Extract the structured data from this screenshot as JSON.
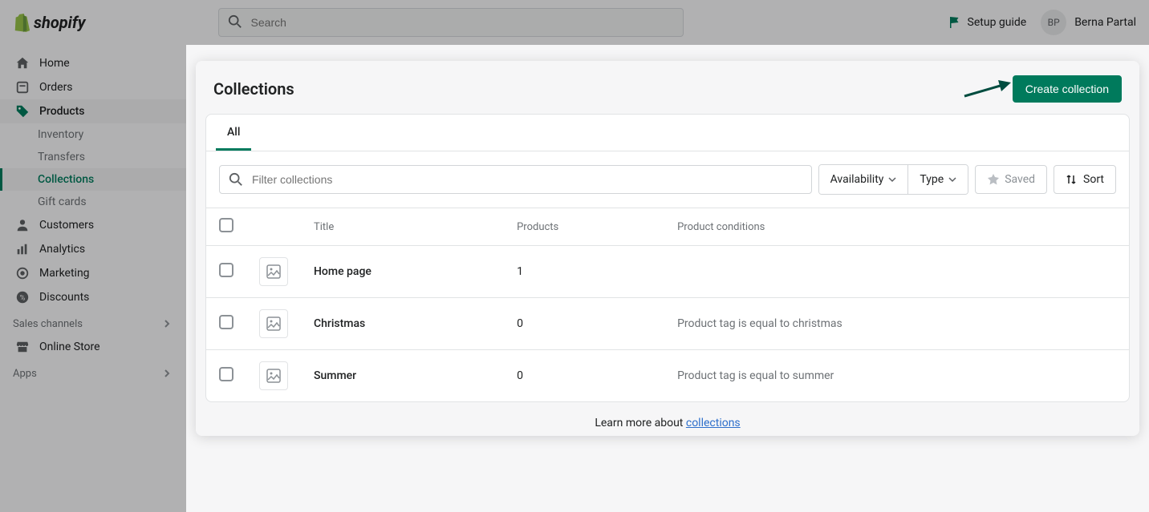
{
  "brand": {
    "name": "shopify"
  },
  "search": {
    "placeholder": "Search"
  },
  "header": {
    "setup_guide": "Setup guide",
    "user_initials": "BP",
    "user_name": "Berna Partal"
  },
  "sidebar": {
    "items": [
      {
        "label": "Home"
      },
      {
        "label": "Orders"
      },
      {
        "label": "Products"
      },
      {
        "label": "Inventory"
      },
      {
        "label": "Transfers"
      },
      {
        "label": "Collections"
      },
      {
        "label": "Gift cards"
      },
      {
        "label": "Customers"
      },
      {
        "label": "Analytics"
      },
      {
        "label": "Marketing"
      },
      {
        "label": "Discounts"
      }
    ],
    "sections": {
      "sales_channels": "Sales channels",
      "online_store": "Online Store",
      "apps": "Apps"
    }
  },
  "page": {
    "title": "Collections",
    "create_button": "Create collection",
    "tabs": {
      "all": "All"
    },
    "filter_placeholder": "Filter collections",
    "availability": "Availability",
    "type": "Type",
    "saved": "Saved",
    "sort": "Sort",
    "columns": {
      "title": "Title",
      "products": "Products",
      "conditions": "Product conditions"
    },
    "rows": [
      {
        "title": "Home page",
        "products": "1",
        "conditions": ""
      },
      {
        "title": "Christmas",
        "products": "0",
        "conditions": "Product tag is equal to christmas"
      },
      {
        "title": "Summer",
        "products": "0",
        "conditions": "Product tag is equal to summer"
      }
    ],
    "footer": {
      "prefix": "Learn more about ",
      "link": "collections"
    }
  }
}
